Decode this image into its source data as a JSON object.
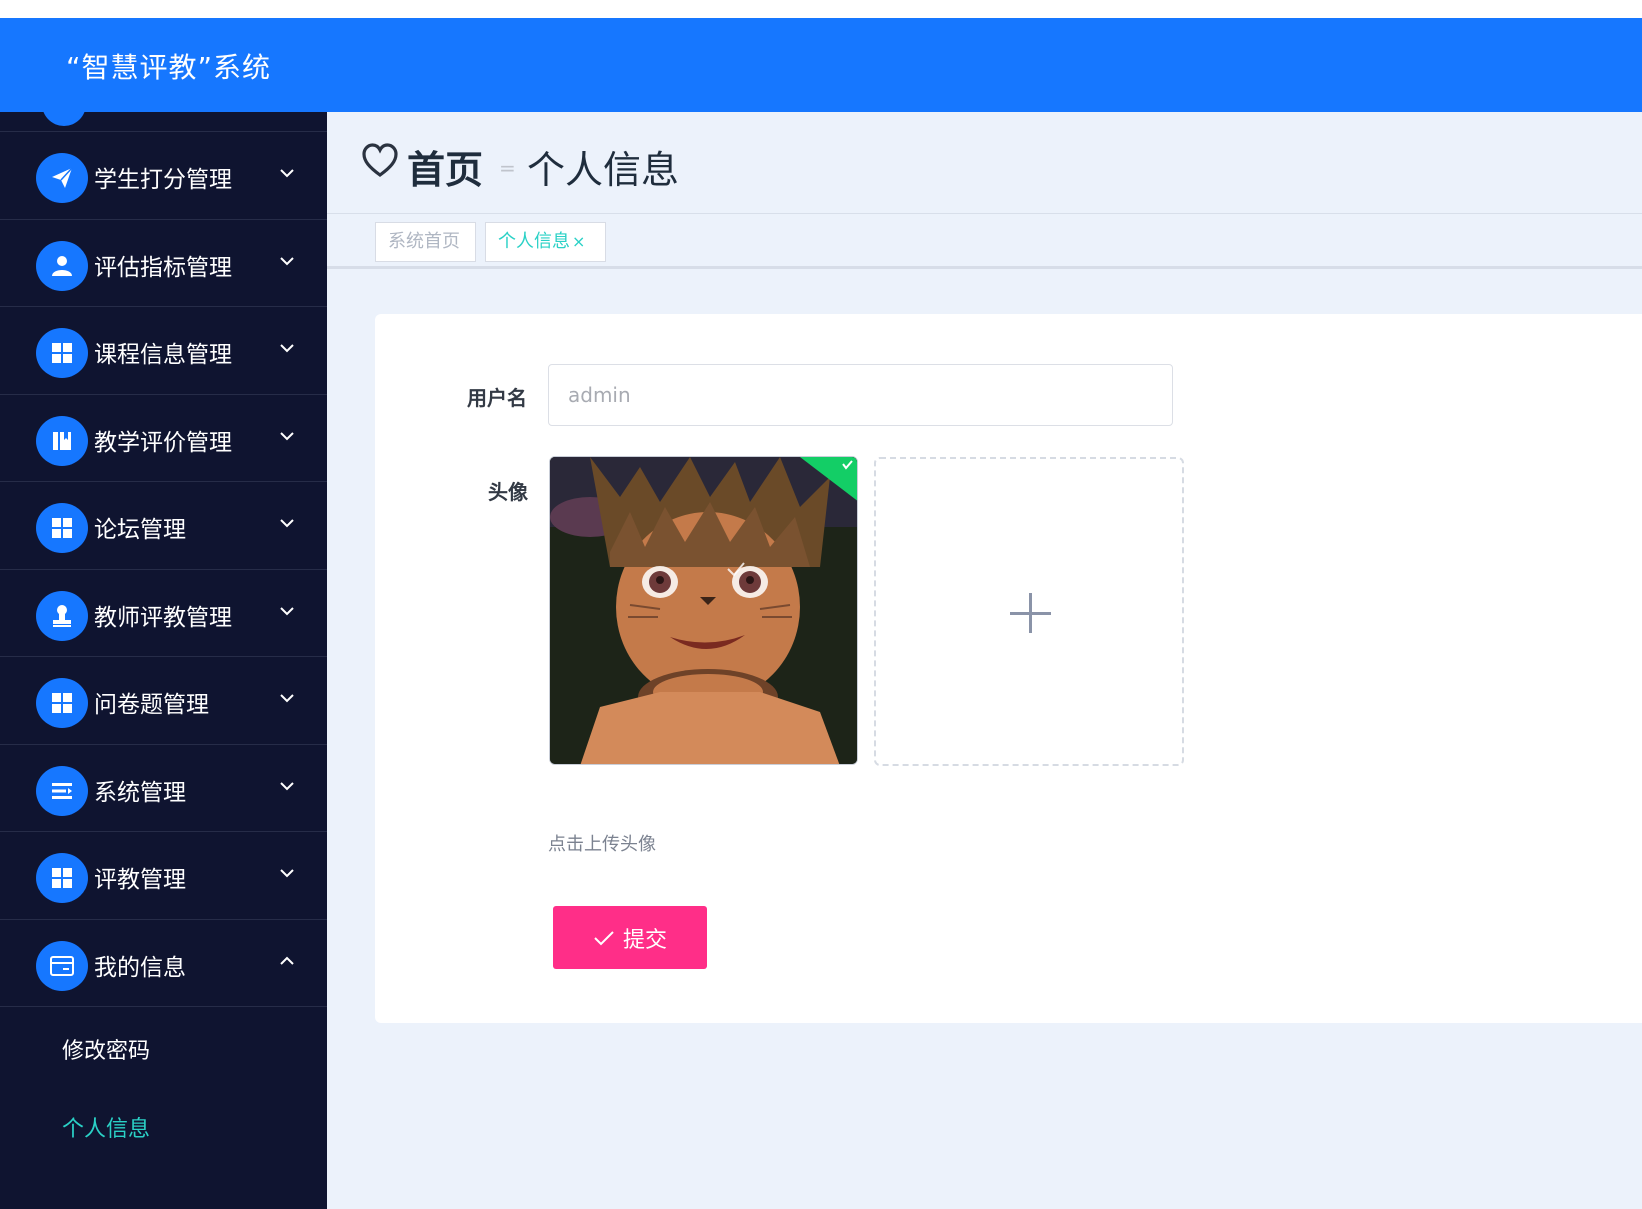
{
  "header": {
    "title": "“智慧评教”系统"
  },
  "sidebar": {
    "items": [
      {
        "label": "学生打分管理",
        "icon": "paper-plane-icon",
        "expanded": false
      },
      {
        "label": "评估指标管理",
        "icon": "user-icon",
        "expanded": false
      },
      {
        "label": "课程信息管理",
        "icon": "grid-icon",
        "expanded": false
      },
      {
        "label": "教学评价管理",
        "icon": "book-icon",
        "expanded": false
      },
      {
        "label": "论坛管理",
        "icon": "grid-icon",
        "expanded": false
      },
      {
        "label": "教师评教管理",
        "icon": "stamp-icon",
        "expanded": false
      },
      {
        "label": "问卷题管理",
        "icon": "grid-icon",
        "expanded": false
      },
      {
        "label": "系统管理",
        "icon": "list-icon",
        "expanded": false
      },
      {
        "label": "评教管理",
        "icon": "grid-icon",
        "expanded": false
      },
      {
        "label": "我的信息",
        "icon": "card-icon",
        "expanded": true
      }
    ],
    "subitems": [
      {
        "label": "修改密码",
        "active": false
      },
      {
        "label": "个人信息",
        "active": true
      }
    ]
  },
  "breadcrumb": {
    "home": "首页",
    "separator": "=",
    "current": "个人信息"
  },
  "tags": [
    {
      "label": "系统首页",
      "active": false
    },
    {
      "label": "个人信息",
      "active": true,
      "close": "×"
    }
  ],
  "form": {
    "username_label": "用户名",
    "username_value": "admin",
    "avatar_label": "头像",
    "upload_hint": "点击上传头像",
    "submit_label": "提交"
  },
  "colors": {
    "header": "#1677ff",
    "sidebar": "#0f1430",
    "accent": "#2ad1c6",
    "submit": "#ff2e88",
    "upload_success": "#13ce66"
  }
}
